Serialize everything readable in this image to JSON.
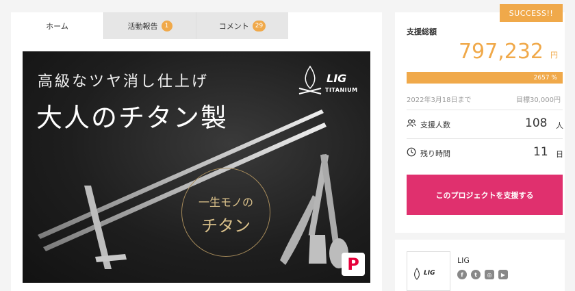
{
  "tabs": [
    {
      "label": "ホーム",
      "badge": ""
    },
    {
      "label": "活動報告",
      "badge": "1"
    },
    {
      "label": "コメント",
      "badge": "29"
    }
  ],
  "hero": {
    "headline1": "高級なツヤ消し仕上げ",
    "headline2": "大人のチタン製",
    "circle_line1": "一生モノの",
    "circle_line2": "チタン",
    "brand": "LIG",
    "brand_sub": "TITANIUM",
    "pay_mark": "P"
  },
  "status_badge": "SUCCESS!!",
  "funding": {
    "label": "支援総額",
    "amount": "797,232",
    "currency": "円",
    "percent_text": "2657 %",
    "progress_fraction": 1.0,
    "deadline": "2022年3月18日まで",
    "goal": "目標30,000円"
  },
  "supporters": {
    "label": "支援人数",
    "value": "108",
    "unit": "人"
  },
  "time_left": {
    "label": "残り時間",
    "value": "11",
    "unit": "日"
  },
  "support_button": "このプロジェクトを支援する",
  "owner": {
    "name": "LIG",
    "logo_text": "LIG",
    "social": [
      "facebook-icon",
      "twitter-icon",
      "instagram-icon",
      "youtube-icon"
    ]
  },
  "colors": {
    "accent": "#f0a94a",
    "cta": "#e0306e"
  }
}
